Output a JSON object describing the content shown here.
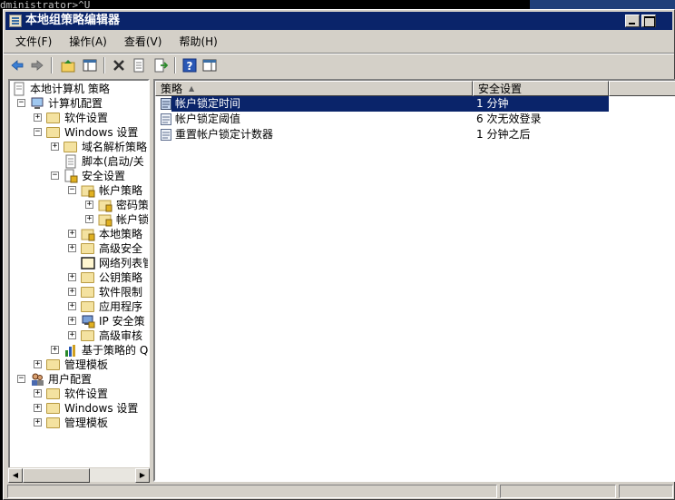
{
  "console": {
    "text": "dministrator>^U"
  },
  "window": {
    "title": "本地组策略编辑器"
  },
  "menu": [
    {
      "label": "文件(F)"
    },
    {
      "label": "操作(A)"
    },
    {
      "label": "查看(V)"
    },
    {
      "label": "帮助(H)"
    }
  ],
  "toolbar": [
    {
      "icon": "back-arrow-icon"
    },
    {
      "icon": "forward-arrow-icon"
    },
    {
      "icon": "up-folder-icon"
    },
    {
      "icon": "show-hide-tree-icon"
    },
    {
      "icon": "delete-icon"
    },
    {
      "icon": "properties-icon"
    },
    {
      "icon": "export-list-icon"
    },
    {
      "icon": "help-icon"
    },
    {
      "icon": "show-action-pane-icon"
    }
  ],
  "tree": {
    "root": "本地计算机 策略",
    "computer_config": "计算机配置",
    "software_settings": "软件设置",
    "windows_settings": "Windows 设置",
    "dns_policy": "域名解析策略",
    "scripts": "脚本(启动/关",
    "security_settings": "安全设置",
    "account_policies": "帐户策略",
    "password_policy": "密码策",
    "lockout_policy": "帐户锁",
    "local_policies": "本地策略",
    "advanced_security": "高级安全",
    "network_list": "网络列表管",
    "public_key": "公钥策略",
    "software_restriction": "软件限制",
    "app_control": "应用程序",
    "ip_security": "IP 安全策",
    "advanced_audit": "高级审核",
    "policy_qos": "基于策略的 Q",
    "admin_templates": "管理模板",
    "user_config": "用户配置",
    "user_software": "软件设置",
    "user_windows": "Windows 设置",
    "user_admin_templates": "管理模板"
  },
  "list": {
    "columns": {
      "policy": "策略",
      "setting": "安全设置"
    },
    "rows": [
      {
        "policy": "帐户锁定时间",
        "setting": "1 分钟",
        "selected": true
      },
      {
        "policy": "帐户锁定阈值",
        "setting": "6 次无效登录",
        "selected": false
      },
      {
        "policy": "重置帐户锁定计数器",
        "setting": "1 分钟之后",
        "selected": false
      }
    ]
  },
  "colors": {
    "titlebar": "#0a246a",
    "face": "#d4d0c8",
    "selection": "#0a246a"
  }
}
